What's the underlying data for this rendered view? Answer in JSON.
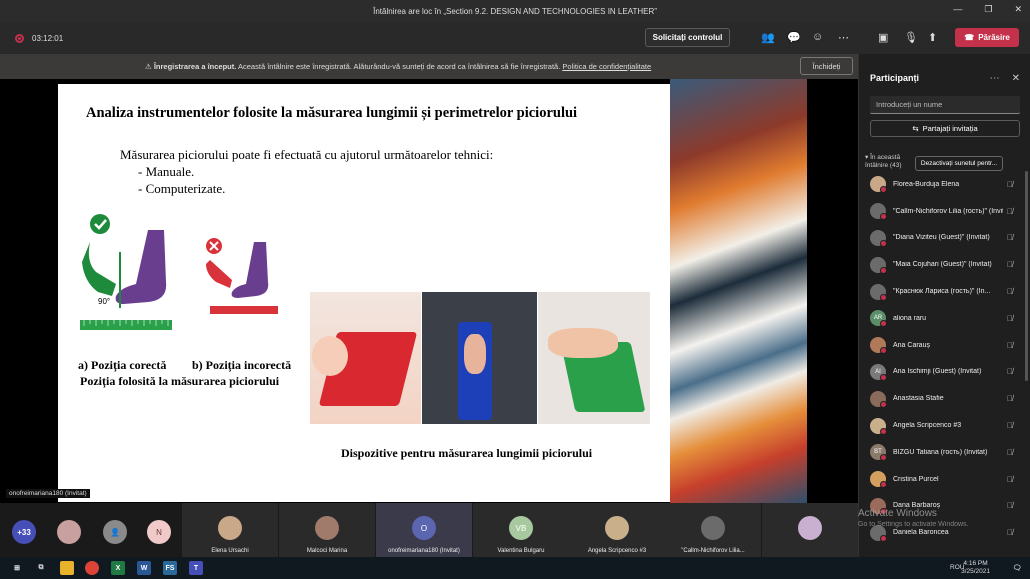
{
  "window": {
    "title": "Întâlnirea are loc în „Section 9.2. DESIGN AND TECHNOLOGIES IN LEATHER”"
  },
  "toolbar": {
    "timer": "03:12:01",
    "request_control": "Solicitați controlul",
    "leave": "Părăsire"
  },
  "banner": {
    "bold": "Înregistrarea a început.",
    "text": " Această întâlnire este înregistrată. Alăturându-vă sunteți de acord ca întâlnirea să fie înregistrată. ",
    "link": "Politica de confidențialitate",
    "close": "Închideți"
  },
  "slide": {
    "title": "Analiza instrumentelor folosite la măsurarea lungimii și perimetrelor piciorului",
    "intro": "Măsurarea piciorului poate fi efectuată cu ajutorul următoarelor tehnici:",
    "items": [
      "- Manuale.",
      "- Computerizate."
    ],
    "angle_label": "90°",
    "caption_a": "a)  Poziția corectă",
    "caption_b": "b) Poziția incorectă",
    "caption_c": "Poziția folosită la măsurarea  piciorului",
    "caption_devices": "Dispozitive pentru măsurarea lungimii piciorului"
  },
  "presenter_label": "onofreimariana180 (Invitat)",
  "panel": {
    "title": "Participanți",
    "search_placeholder": "Introduceți un nume",
    "share": "Partajați invitația",
    "section": "În această întâlnire (43)",
    "mute_all": "Dezactivați sunetul pentr...",
    "participants": [
      {
        "name": "Florea-Burduja Elena",
        "initials": "",
        "color": "#c9a88a"
      },
      {
        "name": "\"Callm-Nichiforov Lilia (гость)\" (Invitat)",
        "initials": "",
        "color": "#6b6b6b"
      },
      {
        "name": "\"Diana Viziteu (Guest)\" (Invitat)",
        "initials": "",
        "color": "#6b6b6b"
      },
      {
        "name": "\"Maia Cojuhari (Guest)\" (Invitat)",
        "initials": "",
        "color": "#6b6b6b"
      },
      {
        "name": "\"Краснюк Лариса (гость)\" (In...",
        "initials": "",
        "color": "#6b6b6b"
      },
      {
        "name": "aliona raru",
        "initials": "AR",
        "color": "#5b8f6a"
      },
      {
        "name": "Ana Carauș",
        "initials": "",
        "color": "#b07a5a"
      },
      {
        "name": "Ana Ischimji (Guest) (Invitat)",
        "initials": "AI",
        "color": "#7a7a7a"
      },
      {
        "name": "Anastasia Stafie",
        "initials": "",
        "color": "#8a6a5a"
      },
      {
        "name": "Angela Scripcenco #3",
        "initials": "",
        "color": "#c9b08a"
      },
      {
        "name": "BÎZGU Tatiana (гость) (Invitat)",
        "initials": "BT",
        "color": "#8a7a6a"
      },
      {
        "name": "Cristina Purcel",
        "initials": "",
        "color": "#d4a060"
      },
      {
        "name": "Dana Barbaroș",
        "initials": "",
        "color": "#9a6a5a"
      },
      {
        "name": "Daniela Baronceа",
        "initials": "",
        "color": "#6b6b6b"
      }
    ]
  },
  "gallery": {
    "more": "+33",
    "n_initial": "N",
    "tiles": [
      {
        "name": "Elena Ursachi",
        "initials": "",
        "color": "#c9a88a"
      },
      {
        "name": "Malcoci Marina",
        "initials": "",
        "color": "#a07a6a"
      },
      {
        "name": "onofreimariana180 (Invitat)",
        "initials": "O",
        "color": "#5a66b0"
      },
      {
        "name": "Valentina Bulgaru",
        "initials": "VB",
        "color": "#a8c9a0"
      },
      {
        "name": "Angela Scripcenco #3",
        "initials": "",
        "color": "#c9b08a"
      },
      {
        "name": "\"Callm-Nichiforov Lilia...",
        "initials": "",
        "color": "#6b6b6b"
      },
      {
        "name": "",
        "initials": "",
        "color": "#c9b0d0"
      }
    ]
  },
  "watermark": {
    "line1": "Activate Windows",
    "line2": "Go to Settings to activate Windows."
  },
  "taskbar": {
    "lang": "ROU",
    "time": "4:16 PM",
    "date": "3/25/2021"
  }
}
